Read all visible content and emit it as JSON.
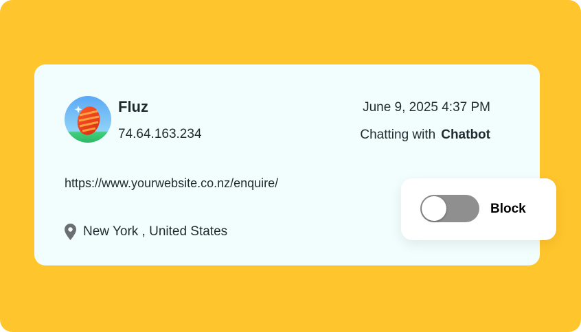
{
  "visitor": {
    "name": "Fluz",
    "ip": "74.64.163.234",
    "datetime": "June 9, 2025 4:37 PM",
    "chatting_prefix": "Chatting with",
    "chatting_with": "Chatbot",
    "url": "https://www.yourwebsite.co.nz/enquire/",
    "location": "New York , United States",
    "avatar_icon": "easter-egg-avatar",
    "location_icon": "map-pin-icon"
  },
  "block": {
    "label": "Block",
    "enabled": false
  },
  "colors": {
    "background": "#FFC52C",
    "card": "#F2FDFD",
    "toggle_off": "#8f8f8f",
    "text": "#1f2b2f"
  }
}
